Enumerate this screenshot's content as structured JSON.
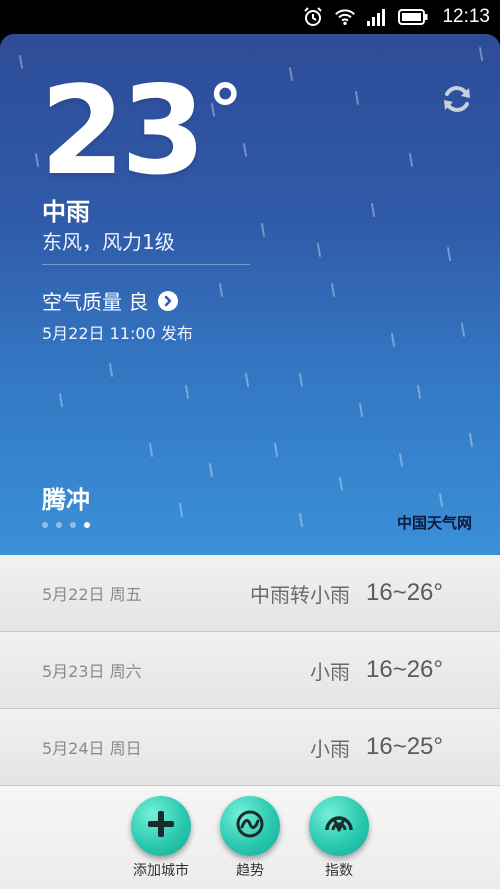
{
  "status_bar": {
    "time": "12:13",
    "icons": [
      "alarm-icon",
      "wifi-icon",
      "signal-icon",
      "battery-icon"
    ]
  },
  "weather": {
    "temperature": "23",
    "degree_symbol": "°",
    "condition": "中雨",
    "wind": "东风，风力1级",
    "air_quality": "空气质量 良",
    "published": "5月22日 11:00 发布",
    "city": "腾冲",
    "brand": "中国天气网",
    "page_count": 4,
    "active_page": 4
  },
  "forecast": [
    {
      "date": "5月22日 周五",
      "desc": "中雨转小雨",
      "range": "16~26°"
    },
    {
      "date": "5月23日 周六",
      "desc": "小雨",
      "range": "16~26°"
    },
    {
      "date": "5月24日 周日",
      "desc": "小雨",
      "range": "16~25°"
    }
  ],
  "actions": [
    {
      "label": "添加城市",
      "icon": "plus-icon"
    },
    {
      "label": "趋势",
      "icon": "trend-icon"
    },
    {
      "label": "指数",
      "icon": "index-icon"
    }
  ],
  "colors": {
    "accent_teal": "#2ac9b0",
    "sky_top": "#2e4c98",
    "sky_bottom": "#3a90d8"
  }
}
